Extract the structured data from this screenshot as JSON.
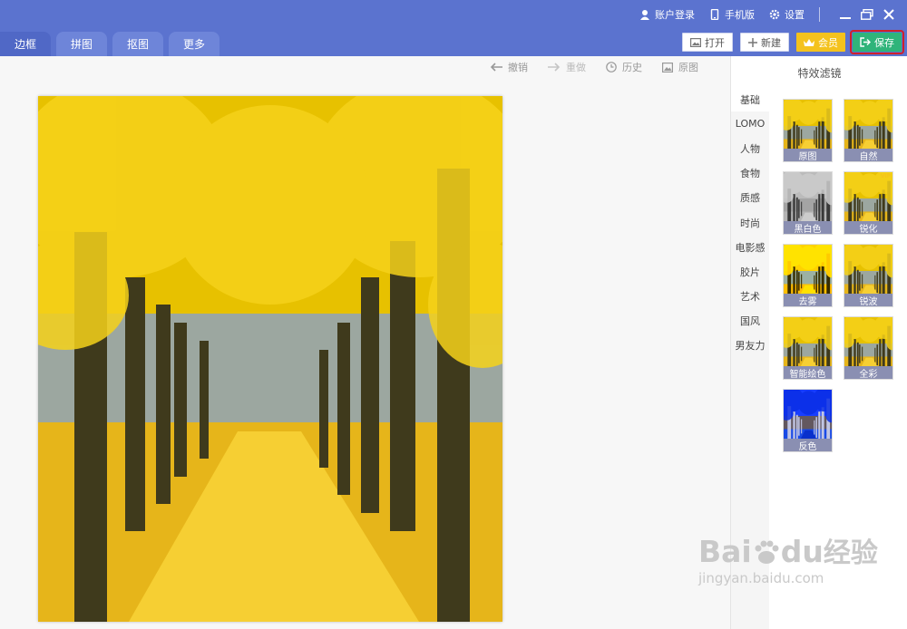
{
  "titlebar": {
    "login": "账户登录",
    "mobile": "手机版",
    "settings": "设置"
  },
  "tabs": [
    "边框",
    "拼图",
    "抠图",
    "更多"
  ],
  "actions": {
    "open": "打开",
    "new": "新建",
    "vip": "会员",
    "save": "保存"
  },
  "toolbar": {
    "undo": "撤销",
    "redo": "重做",
    "history": "历史",
    "original": "原图"
  },
  "panel": {
    "title": "特效滤镜",
    "categories": [
      "基础",
      "LOMO",
      "人物",
      "食物",
      "质感",
      "时尚",
      "电影感",
      "胶片",
      "艺术",
      "国风",
      "男友力"
    ],
    "filters": [
      "原图",
      "自然",
      "黑白色",
      "锐化",
      "去雾",
      "锐波",
      "智能绘色",
      "全彩",
      "反色"
    ],
    "vip_badge": "VIP"
  },
  "watermark": {
    "brand": "Bai",
    "brand_suffix": "du",
    "brand_cn": "经验",
    "url": "jingyan.baidu.com"
  },
  "colors": {
    "topbar": "#5b73cf",
    "save": "#2fb47a",
    "vip": "#f4c21d",
    "highlight": "#d0202a"
  }
}
